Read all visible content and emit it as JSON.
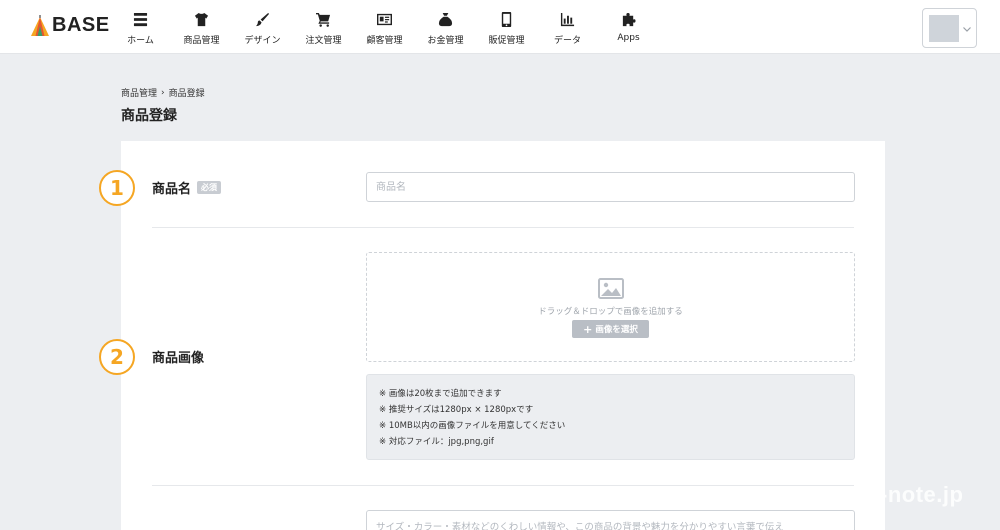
{
  "brand": {
    "name": "BASE"
  },
  "nav": [
    {
      "label": "ホーム",
      "icon": "list-icon"
    },
    {
      "label": "商品管理",
      "icon": "tshirt-icon"
    },
    {
      "label": "デザイン",
      "icon": "brush-icon"
    },
    {
      "label": "注文管理",
      "icon": "cart-icon"
    },
    {
      "label": "顧客管理",
      "icon": "id-card-icon"
    },
    {
      "label": "お金管理",
      "icon": "money-bag-icon"
    },
    {
      "label": "販促管理",
      "icon": "phone-icon"
    },
    {
      "label": "データ",
      "icon": "bar-chart-icon"
    },
    {
      "label": "Apps",
      "icon": "puzzle-icon"
    }
  ],
  "breadcrumb": {
    "parent": "商品管理",
    "separator": "›",
    "current": "商品登録"
  },
  "page": {
    "title": "商品登録"
  },
  "form": {
    "name": {
      "step": "1",
      "label": "商品名",
      "required_badge": "必須",
      "placeholder": "商品名"
    },
    "image": {
      "step": "2",
      "label": "商品画像",
      "dropzone_text": "ドラッグ＆ドロップで画像を追加する",
      "select_button": "画像を選択",
      "notes": [
        "※ 画像は20枚まで追加できます",
        "※ 推奨サイズは1280px × 1280pxです",
        "※ 10MB以内の画像ファイルを用意してください",
        "※ 対応ファイル：jpg,png,gif"
      ]
    },
    "description": {
      "placeholder": "サイズ・カラー・素材などのくわしい情報や、この商品の背景や魅力を分かりやすい言葉で伝え"
    }
  },
  "watermark": "-note.jp",
  "colors": {
    "accent": "#f5a623",
    "background": "#eceef1",
    "card": "#ffffff"
  }
}
